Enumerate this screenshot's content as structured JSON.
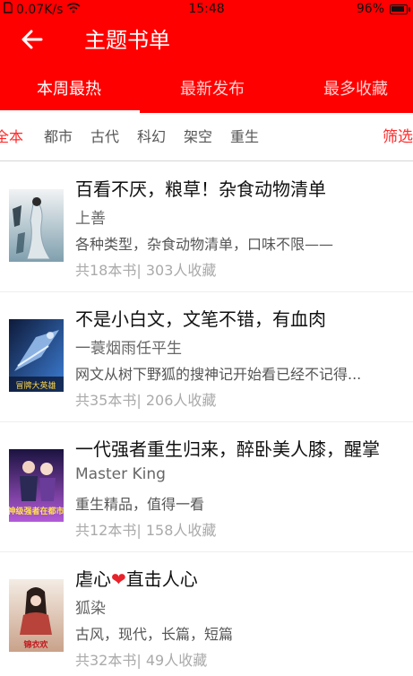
{
  "status_bar": {
    "speed": "0.07K/s",
    "time": "15:48",
    "battery": "96%",
    "battery_level": 0.96,
    "icons": [
      "sim-icon",
      "wifi-icon",
      "battery-icon"
    ]
  },
  "header": {
    "title": "主题书单",
    "back_icon": "arrow-left-icon"
  },
  "tabs": [
    {
      "label": "本周最热",
      "active": true
    },
    {
      "label": "最新发布",
      "active": false
    },
    {
      "label": "最多收藏",
      "active": false
    }
  ],
  "filters": {
    "items": [
      "全本",
      "都市",
      "古代",
      "科幻",
      "架空",
      "重生"
    ],
    "active_index": 0,
    "filter_button": "筛选"
  },
  "booklists": [
    {
      "title": "百看不厌，粮草！杂食动物清单",
      "author": "上善",
      "desc": "各种类型，杂食动物清单，口味不限——",
      "books": "共18本书",
      "sep": "|",
      "favs": "303人收藏",
      "cover_text": "",
      "cover_colors": [
        "#f1f3f4",
        "#7f9fae"
      ]
    },
    {
      "title": "不是小白文，文笔不错，有血肉",
      "author": "一蓑烟雨任平生",
      "desc": "网文从树下野狐的搜神记开始看已经不记得...",
      "books": "共35本书",
      "sep": "|",
      "favs": "206人收藏",
      "cover_text": "冒牌大英雄",
      "cover_colors": [
        "#0e1a3a",
        "#3d7fd6"
      ]
    },
    {
      "title": " 一代强者重生归来，醉卧美人膝，醒掌",
      "author": "Master King",
      "desc": "重生精品，值得一看",
      "books": "共12本书",
      "sep": "|",
      "favs": "158人收藏",
      "cover_text": "神级强者在都市",
      "cover_colors": [
        "#1b1340",
        "#b25ad8"
      ]
    },
    {
      "title_before": "虐心",
      "title_heart": "❤",
      "title_after": "直击人心",
      "author": "狐染",
      "desc": "古风，现代，长篇，短篇",
      "books": "共32本书",
      "sep": "|",
      "favs": "49人收藏",
      "cover_text": "锦衣欢",
      "cover_colors": [
        "#f4ece4",
        "#c9a28a"
      ]
    }
  ],
  "colors": {
    "brand_red": "#ff0000",
    "accent_red": "#ff2a2a"
  }
}
